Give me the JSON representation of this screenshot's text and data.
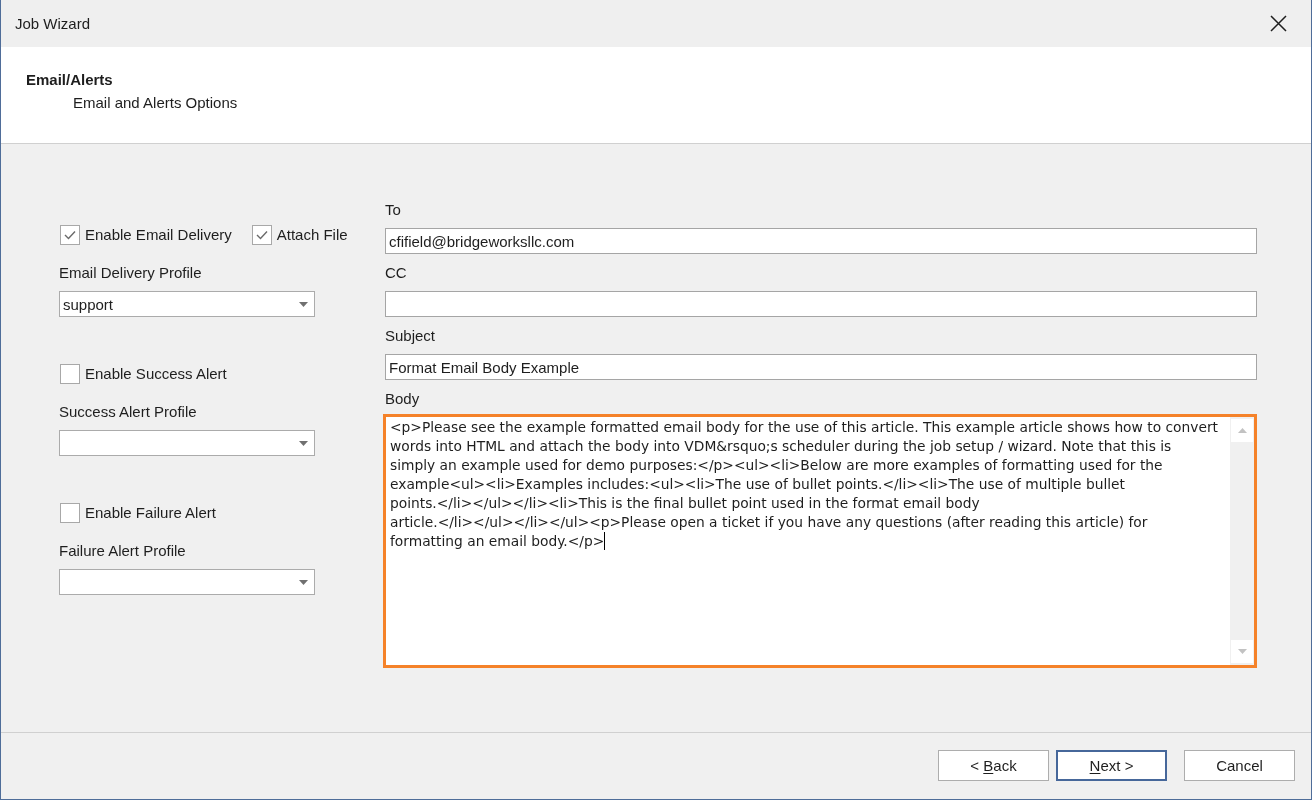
{
  "window": {
    "title": "Job Wizard"
  },
  "header": {
    "title": "Email/Alerts",
    "subtitle": "Email and Alerts Options"
  },
  "left_panel": {
    "sections": [
      {
        "checkboxes": [
          {
            "label": "Enable Email Delivery",
            "checked": true
          },
          {
            "label": "Attach File",
            "checked": true
          }
        ],
        "profile": {
          "label": "Email Delivery Profile",
          "value": "support"
        }
      },
      {
        "checkboxes": [
          {
            "label": "Enable Success Alert",
            "checked": false
          }
        ],
        "profile": {
          "label": "Success Alert Profile"
        }
      },
      {
        "checkboxes": [
          {
            "label": "Enable Failure Alert",
            "checked": false
          }
        ],
        "profile": {
          "label": "Failure Alert Profile"
        }
      }
    ]
  },
  "message": {
    "fields": [
      {
        "label": "To",
        "value": "cfifield@bridgeworksllc.com"
      },
      {
        "label": "CC"
      },
      {
        "label": "Subject",
        "value": "Format Email Body Example"
      }
    ],
    "body": {
      "label": "Body",
      "focused": true,
      "value": "<p>Please see the example formatted email body for the use of this article. This example article shows how to convert words into HTML and attach the body into VDM&rsquo;s scheduler during the job setup / wizard. Note that this is simply an example used for demo purposes:</p><ul><li>Below are more examples of formatting used for the example<ul><li>Examples includes:<ul><li>The use of bullet points.</li><li>The use of multiple bullet points.</li></ul></li><li>This is the final bullet point used in the format email body article.</li></ul></li></ul><p>Please open a ticket if you have any questions (after reading this article) for formatting an email body.</p>"
    }
  },
  "buttons": [
    {
      "default": false,
      "label_parts": [
        {
          "text": "< ",
          "underlined": false
        },
        {
          "text": "B",
          "underlined": true
        },
        {
          "text": "ack",
          "underlined": false
        }
      ]
    },
    {
      "default": true,
      "label_parts": [
        {
          "text": "N",
          "underlined": true
        },
        {
          "text": "ext >",
          "underlined": false
        }
      ]
    },
    {
      "default": false,
      "label_parts": [
        {
          "text": "Cancel",
          "underlined": false
        }
      ]
    }
  ]
}
